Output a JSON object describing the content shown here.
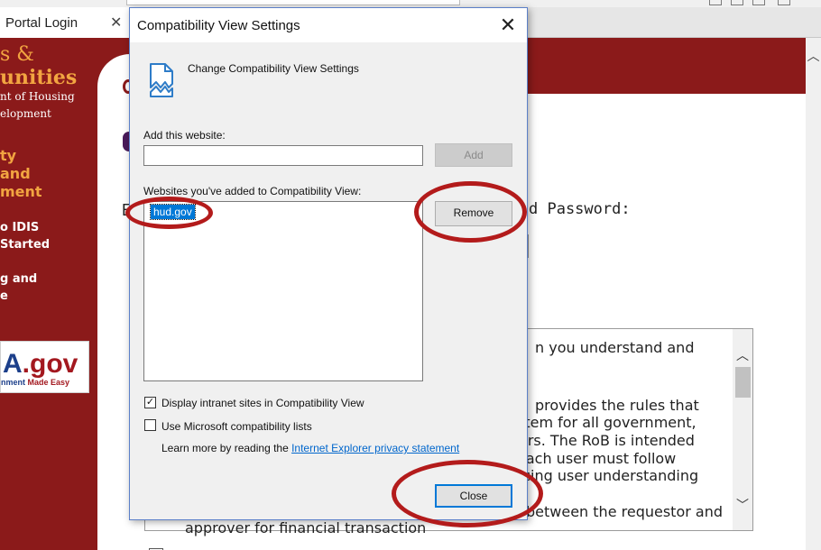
{
  "browser": {
    "tab_title": "Portal Login",
    "tab_close": "✕"
  },
  "page": {
    "logo_line1": "s &",
    "logo_line2": "unities",
    "logo_sub1": "nt of Housing",
    "logo_sub2": "elopment",
    "side_heading": "ty\nand\nment",
    "side_links": [
      "o IDIS\nStarted",
      "g and\ne"
    ],
    "usa_logo_main_a": "A",
    "usa_logo_main": ".gov",
    "usa_logo_tag": "nment ",
    "usa_logo_tag_red": "Made Easy",
    "password_label": "d Password:",
    "frag_e": "E",
    "rob_lines": [
      "n you understand and",
      "provides the rules that",
      "stem for all government,",
      "ers. The RoB is intended",
      "each user must follow",
      "rcing user understanding",
      "between the requestor and"
    ],
    "below_text": "approver for financial transaction"
  },
  "dialog": {
    "title": "Compatibility View Settings",
    "close": "✕",
    "header": "Change Compatibility View Settings",
    "add_label": "Add this website:",
    "add_value": "",
    "add_button": "Add",
    "list_label": "Websites you've added to Compatibility View:",
    "sites": [
      "hud.gov"
    ],
    "remove_button": "Remove",
    "chk_intranet_label": "Display intranet sites in Compatibility View",
    "chk_intranet_checked": true,
    "chk_mslists_label": "Use Microsoft compatibility lists",
    "chk_mslists_checked": false,
    "learn_more_text": "Learn more by reading the ",
    "learn_more_link": "Internet Explorer privacy statement",
    "close_button": "Close",
    "check_mark": "✓"
  },
  "icons": {
    "tab_close": "close-icon",
    "dialog_close": "close-icon",
    "header_icon": "broken-page-icon"
  },
  "colors": {
    "brand_red": "#8b1a1a",
    "brand_gold": "#f2a541",
    "selection_blue": "#0078d7",
    "annotation_red": "#b31b1b"
  }
}
